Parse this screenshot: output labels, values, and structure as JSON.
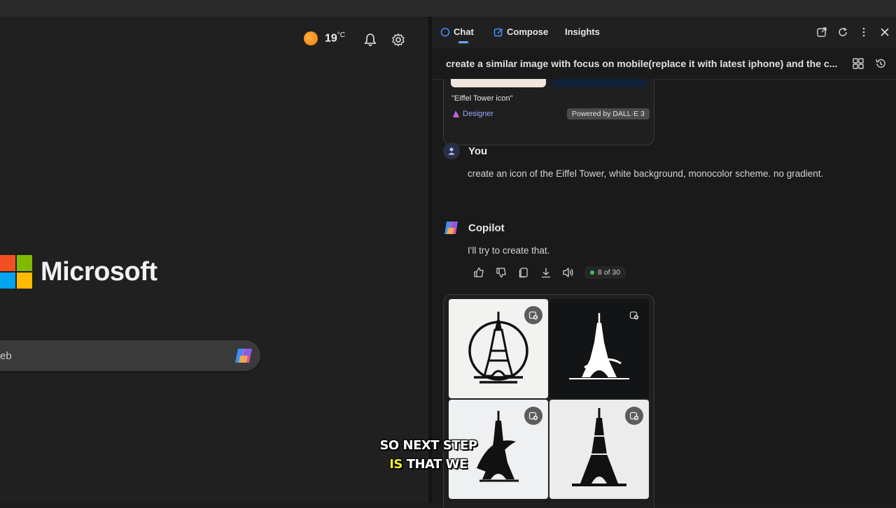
{
  "left": {
    "weather": {
      "temp": "19",
      "unit": "°C"
    },
    "brand": "Microsoft",
    "search": {
      "placeholder_fragment": "eb"
    }
  },
  "sidebar": {
    "tabs": [
      {
        "label": "Chat",
        "active": true
      },
      {
        "label": "Compose",
        "active": false
      },
      {
        "label": "Insights",
        "active": false
      }
    ],
    "conversation_title": "create a similar image with focus on mobile(replace it with latest iphone) and the c...",
    "previous_card": {
      "caption": "\"Eiffel Tower icon\"",
      "designer_label": "Designer",
      "powered_label": "Powered by DALL·E 3"
    },
    "user_message": {
      "author": "You",
      "text": "create an icon of the Eiffel Tower, white background, monocolor scheme. no gradient."
    },
    "copilot_message": {
      "author": "Copilot",
      "text": "I'll try to create that.",
      "counter": "8 of 30"
    }
  },
  "subtitle": {
    "line1": "SO NEXT STEP",
    "line2_highlight": "IS",
    "line2_rest": "THAT WE"
  },
  "colors": {
    "accent": "#6aa9ff",
    "counter_dot": "#3fbf62",
    "subtitle_highlight": "#f4f02a"
  }
}
